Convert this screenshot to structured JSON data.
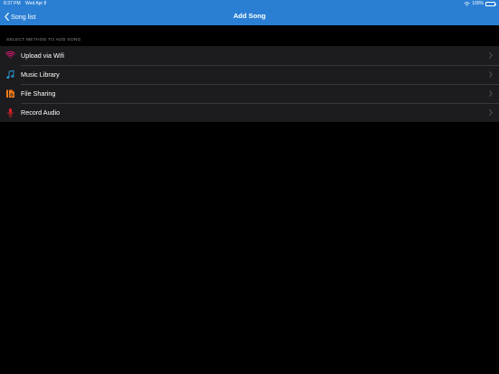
{
  "status_bar": {
    "time": "8:37 PM",
    "date": "Wed Apr 8",
    "battery": "100%"
  },
  "nav": {
    "back_label": "Song list",
    "title": "Add Song"
  },
  "section": {
    "header": "SELECT METHOD TO ADD SONG"
  },
  "items": [
    {
      "label": "Upload via Wifi",
      "icon": "wifi-icon",
      "color": "#e5197a"
    },
    {
      "label": "Music Library",
      "icon": "music-note-icon",
      "color": "#2a9fe0"
    },
    {
      "label": "File Sharing",
      "icon": "file-sharing-icon",
      "color": "#f07a1c"
    },
    {
      "label": "Record Audio",
      "icon": "microphone-icon",
      "color": "#e0202a"
    }
  ],
  "colors": {
    "header": "#2a7fd4",
    "background": "#000000",
    "list_background": "#1c1c1e",
    "section_text": "#8e8e93",
    "chevron": "#5a5a5f"
  }
}
